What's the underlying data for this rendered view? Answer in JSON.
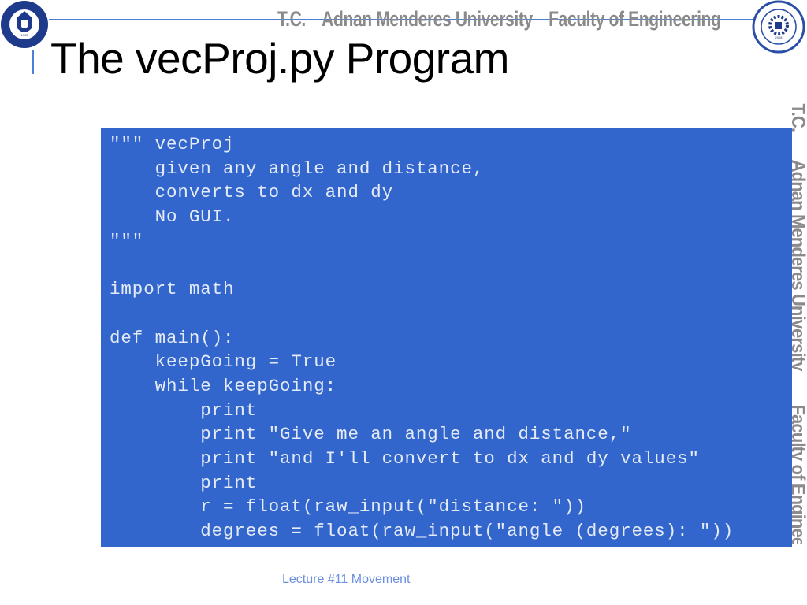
{
  "header": {
    "banner_parts": [
      "T.C.",
      "Adnan Menderes University",
      "Faculty of Engineering"
    ],
    "left_logo": {
      "name": "adnan-menderes-university-logo",
      "ring_text": "ADNAN MENDERES ÜNİVERSİTESİ",
      "year": "1992"
    },
    "right_logo": {
      "name": "engineering-faculty-logo",
      "ring_text_top": "ADNAN MENDERES UNIVERSITY",
      "ring_text_bottom": "ENGINEERING FACULTY",
      "year": "2008"
    },
    "accent_color": "#4a7fd4"
  },
  "slide": {
    "title": "The vecProj.py Program"
  },
  "side_banner": {
    "parts": [
      "T.C.",
      "Adnan Menderes University",
      "Faculty of Engineering"
    ]
  },
  "code": {
    "background_color": "#3366cc",
    "text_color": "#e4ebf7",
    "lines": [
      "\"\"\" vecProj",
      "    given any angle and distance,",
      "    converts to dx and dy",
      "    No GUI.",
      "\"\"\"",
      "",
      "import math",
      "",
      "def main():",
      "    keepGoing = True",
      "    while keepGoing:",
      "        print",
      "        print \"Give me an angle and distance,\"",
      "        print \"and I'll convert to dx and dy values\"",
      "        print",
      "        r = float(raw_input(\"distance: \"))",
      "        degrees = float(raw_input(\"angle (degrees): \"))"
    ]
  },
  "footer": {
    "text": "Lecture #11 Movement",
    "color": "#6b8fe0"
  }
}
